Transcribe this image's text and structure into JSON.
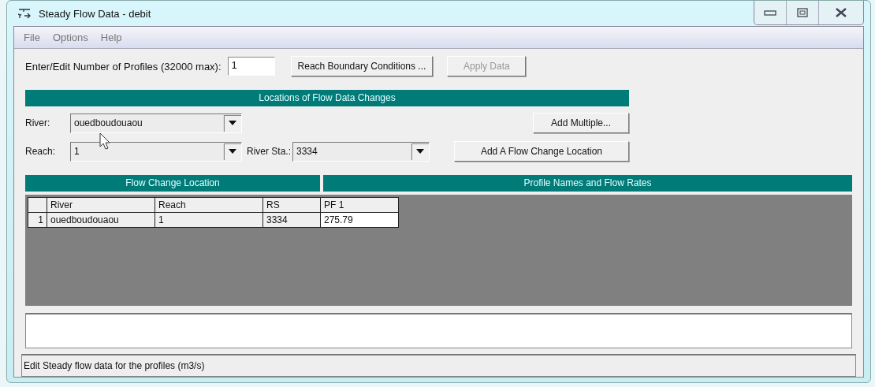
{
  "window": {
    "title": "Steady Flow Data - debit"
  },
  "menu": [
    "File",
    "Options",
    "Help"
  ],
  "profiles": {
    "label": "Enter/Edit Number of Profiles (32000 max):",
    "value": "1"
  },
  "top_buttons": [
    {
      "label": "Reach Boundary Conditions ...",
      "disabled": false
    },
    {
      "label": "Apply Data",
      "disabled": true
    }
  ],
  "locations": {
    "title": "Locations of Flow Data Changes",
    "river": {
      "label": "River:",
      "value": "ouedboudouaou"
    },
    "reach": {
      "label": "Reach:",
      "value": "1"
    },
    "river_station": {
      "label": "River Sta.:",
      "value": "3334"
    },
    "add_multiple_button": "Add Multiple...",
    "add_location_button": "Add A Flow Change Location"
  },
  "table": {
    "group_headers": [
      "Flow Change Location",
      "Profile Names and Flow Rates"
    ],
    "columns": [
      "River",
      "Reach",
      "RS",
      "PF 1"
    ],
    "rows": [
      {
        "number": "1",
        "cells": [
          "ouedboudouaou",
          "1",
          "3334",
          "275.79"
        ]
      }
    ]
  },
  "status_bar": "Edit Steady flow data for the profiles (m3/s)"
}
